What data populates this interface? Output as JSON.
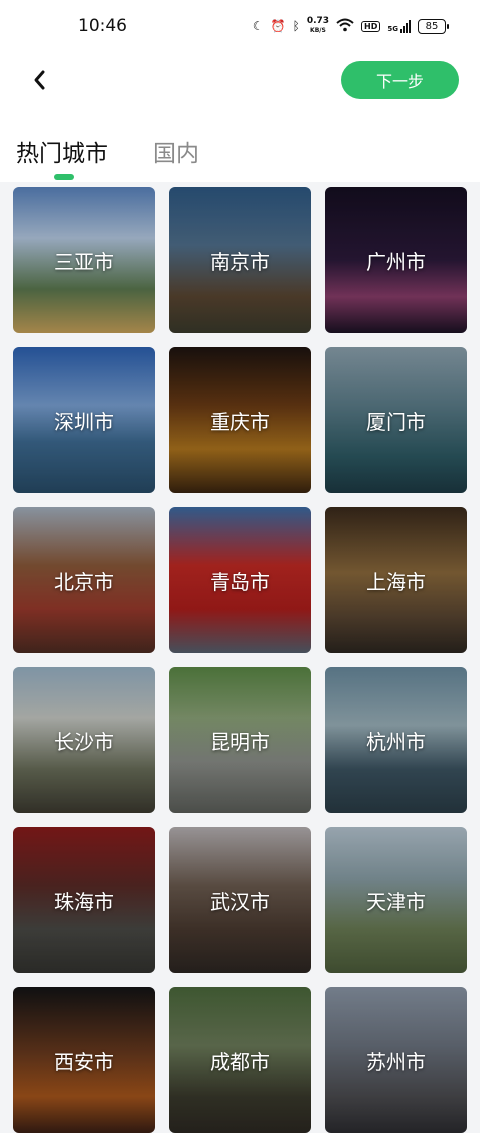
{
  "status": {
    "time": "10:46",
    "net_speed_value": "0.73",
    "net_speed_unit": "KB/S",
    "hd": "HD",
    "signal_label": "5G",
    "battery": "85"
  },
  "header": {
    "next_label": "下一步",
    "tabs": [
      {
        "label": "热门城市",
        "active": true
      },
      {
        "label": "国内",
        "active": false
      }
    ]
  },
  "cities": [
    {
      "name": "三亚市",
      "bg": "linear-gradient(180deg,#5b86c2 0%,#b8cde6 35%,#5c7a50 70%,#c9a35a 100%)"
    },
    {
      "name": "南京市",
      "bg": "linear-gradient(180deg,#2e5a86 0%,#51718e 40%,#5a4631 75%,#3a3a2c 100%)"
    },
    {
      "name": "广州市",
      "bg": "linear-gradient(180deg,#160f22 0%,#2c1a3b 50%,#8a3d6b 75%,#1b1224 100%)"
    },
    {
      "name": "深圳市",
      "bg": "linear-gradient(180deg,#2d63b5 0%,#7ba3d6 40%,#3e6c94 65%,#284c68 100%)"
    },
    {
      "name": "重庆市",
      "bg": "linear-gradient(180deg,#1e1410 0%,#6b3b14 40%,#b0761e 70%,#3a2410 100%)"
    },
    {
      "name": "厦门市",
      "bg": "linear-gradient(180deg,#8ea4b1 0%,#5d7f8c 40%,#2d5a64 75%,#1d3a44 100%)"
    },
    {
      "name": "北京市",
      "bg": "linear-gradient(180deg,#a6b3c2 0%,#8c5a3a 40%,#9b3a2c 70%,#4d2c22 100%)"
    },
    {
      "name": "青岛市",
      "bg": "linear-gradient(180deg,#3c6ea8 0%,#c42a24 40%,#b01e1c 70%,#55616f 100%)"
    },
    {
      "name": "上海市",
      "bg": "linear-gradient(180deg,#3a2a1c 0%,#8c6a3c 45%,#5a4632 75%,#2c2620 100%)"
    },
    {
      "name": "长沙市",
      "bg": "linear-gradient(180deg,#9bb5c8 0%,#c8cbc6 35%,#6a6f5a 70%,#3c3a30 100%)"
    },
    {
      "name": "昆明市",
      "bg": "linear-gradient(180deg,#5c8a46 0%,#8da57a 35%,#8c8f8a 65%,#5c5f5a 100%)"
    },
    {
      "name": "杭州市",
      "bg": "linear-gradient(180deg,#6a8ca0 0%,#9cb3bc 40%,#3c5462 70%,#2a3c46 100%)"
    },
    {
      "name": "珠海市",
      "bg": "linear-gradient(180deg,#8c1c1c 0%,#5a2a26 40%,#4a4a46 70%,#33332f 100%)"
    },
    {
      "name": "武汉市",
      "bg": "linear-gradient(180deg,#b9b4b6 0%,#6c5c50 40%,#4a3a30 70%,#2c2622 100%)"
    },
    {
      "name": "天津市",
      "bg": "linear-gradient(180deg,#b8c8d4 0%,#8aa0a8 35%,#6a7c54 70%,#4c5c3a 100%)"
    },
    {
      "name": "西安市",
      "bg": "linear-gradient(180deg,#141416 0%,#6a3a1e 45%,#a8561c 75%,#3a1f14 100%)"
    },
    {
      "name": "成都市",
      "bg": "linear-gradient(180deg,#4c6a3c 0%,#6c7c5a 40%,#3a3a2c 75%,#2c2822 100%)"
    },
    {
      "name": "苏州市",
      "bg": "linear-gradient(180deg,#8c98a8 0%,#6c7480 40%,#4c4c50 75%,#2c2c30 100%)"
    }
  ]
}
